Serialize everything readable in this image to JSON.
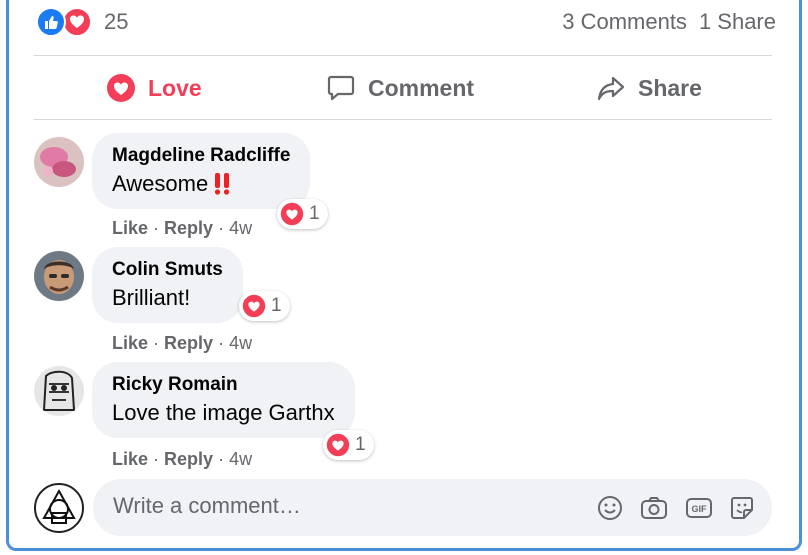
{
  "summary": {
    "reaction_count": "25",
    "comments_count": "3 Comments",
    "shares_count": "1 Share",
    "reactions": [
      "like-icon",
      "love-icon"
    ]
  },
  "actions": {
    "love_label": "Love",
    "comment_label": "Comment",
    "share_label": "Share"
  },
  "comments": [
    {
      "author": "Magdeline Radcliffe",
      "text": "Awesome",
      "emoji": "‼️",
      "reactions": "1",
      "like_label": "Like",
      "reply_label": "Reply",
      "age": "4w"
    },
    {
      "author": "Colin Smuts",
      "text": "Brilliant!",
      "reactions": "1",
      "like_label": "Like",
      "reply_label": "Reply",
      "age": "4w"
    },
    {
      "author": "Ricky Romain",
      "text": "Love the image Garthx",
      "reactions": "1",
      "like_label": "Like",
      "reply_label": "Reply",
      "age": "4w"
    }
  ],
  "composer": {
    "placeholder": "Write a comment…",
    "tools": [
      "emoji-icon",
      "camera-icon",
      "gif-icon",
      "sticker-icon"
    ]
  },
  "colors": {
    "love": "#f33e58",
    "like": "#1b7cf2",
    "frame": "#4a90d9",
    "bubble": "#f0f2f5",
    "muted": "#65676b"
  }
}
